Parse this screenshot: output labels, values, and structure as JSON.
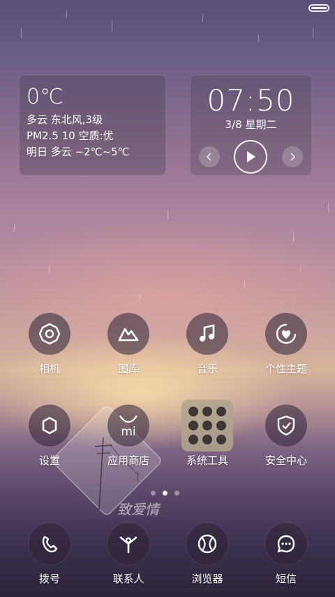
{
  "weather": {
    "temperature": "0℃",
    "condition_wind": "多云 东北风,3级",
    "air_quality": "PM2.5 10 空质:优",
    "forecast": "明日 多云 −2℃~5℃"
  },
  "clock": {
    "time": "07:50",
    "date": "3/8 星期二"
  },
  "apps": {
    "row1": [
      {
        "label": "相机",
        "icon": "camera-icon"
      },
      {
        "label": "图库",
        "icon": "gallery-icon"
      },
      {
        "label": "音乐",
        "icon": "music-icon"
      },
      {
        "label": "个性主题",
        "icon": "theme-icon"
      }
    ],
    "row2": [
      {
        "label": "设置",
        "icon": "settings-icon"
      },
      {
        "label": "应用商店",
        "icon": "app-store-icon"
      },
      {
        "label": "系统工具",
        "icon": "folder-icon"
      },
      {
        "label": "安全中心",
        "icon": "shield-icon"
      }
    ],
    "dock": [
      {
        "label": "拨号",
        "icon": "phone-icon"
      },
      {
        "label": "联系人",
        "icon": "contacts-icon"
      },
      {
        "label": "浏览器",
        "icon": "browser-icon"
      },
      {
        "label": "短信",
        "icon": "message-icon"
      }
    ]
  },
  "app_store_logo_text": "mi",
  "wallpaper_text": "致爱情",
  "pager": {
    "pages": 3,
    "active": 1
  }
}
